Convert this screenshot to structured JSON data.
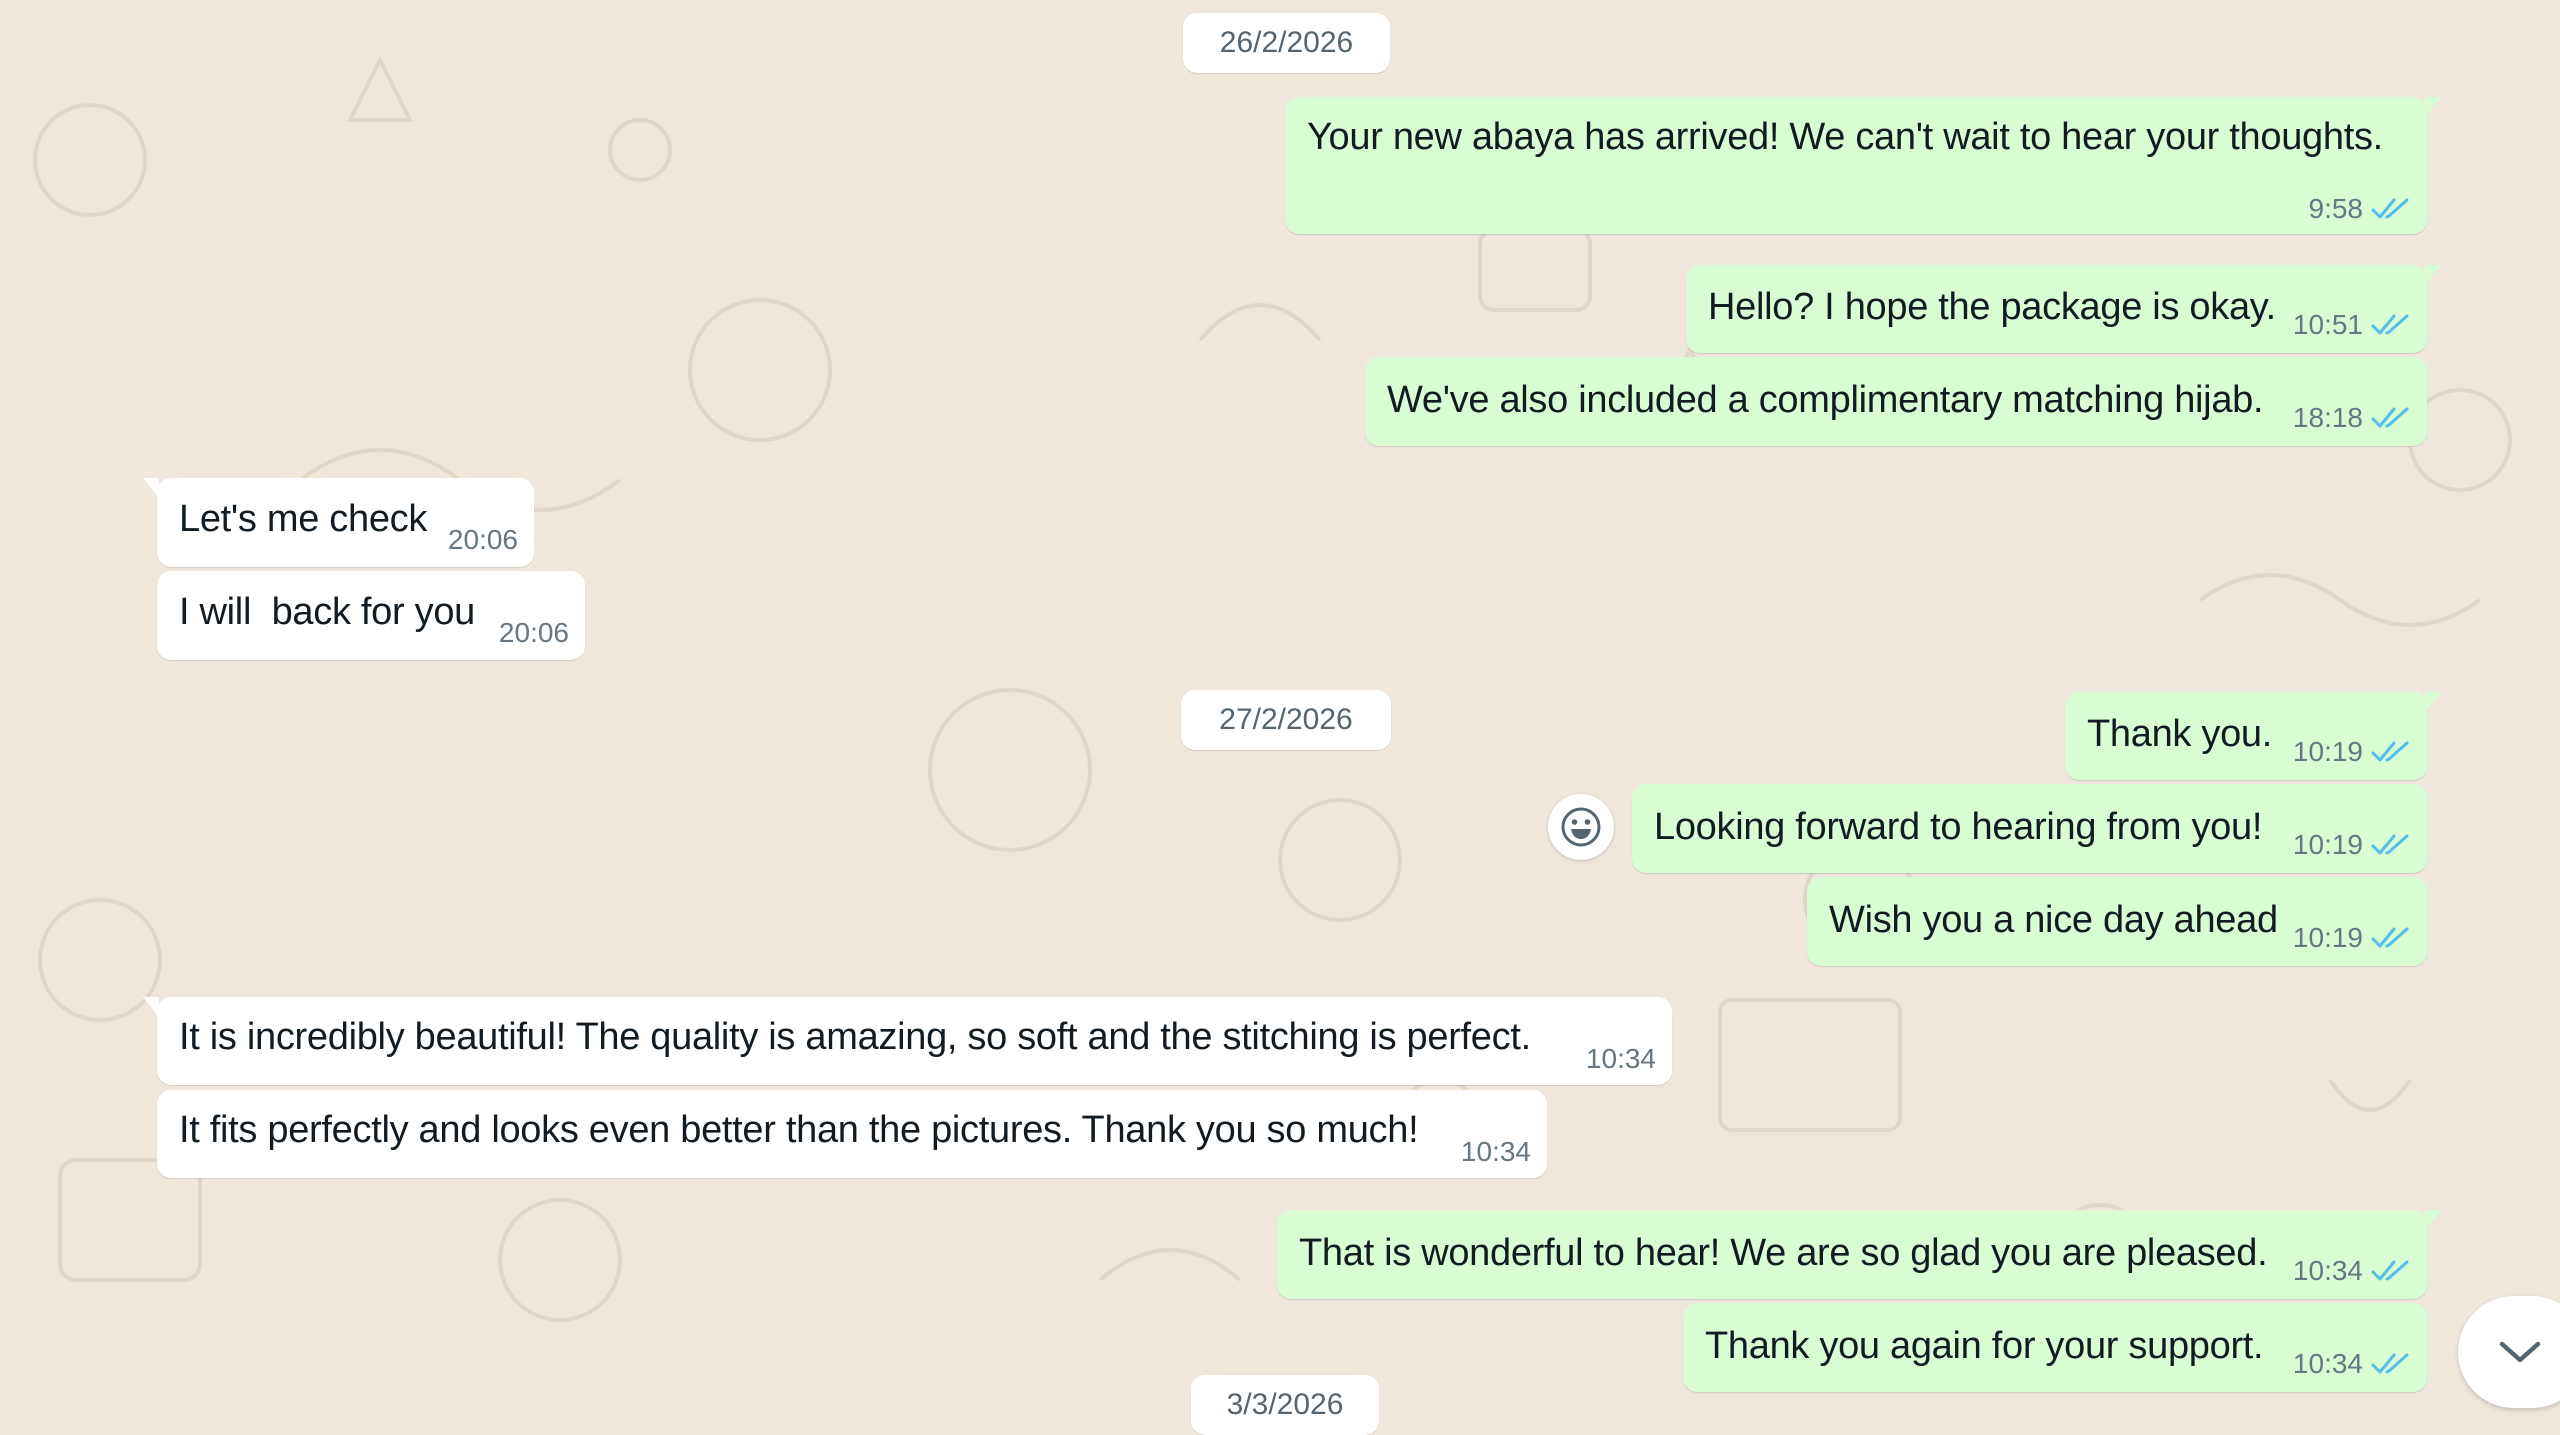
{
  "colors": {
    "background": "#efe7dc",
    "outgoing_bubble": "#d9fdd3",
    "incoming_bubble": "#ffffff",
    "read_ticks": "#53bdeb",
    "timestamp": "#667781"
  },
  "dates": [
    "26/2/2026",
    "27/2/2026",
    "3/3/2026"
  ],
  "messages": [
    {
      "direction": "outgoing",
      "text": "Your new abaya has arrived! We can't wait to hear your thoughts.",
      "time": "9:58",
      "status": "read"
    },
    {
      "direction": "outgoing",
      "text": "Hello? I hope the package is okay.",
      "time": "10:51",
      "status": "read"
    },
    {
      "direction": "outgoing",
      "text": "We've also included a complimentary matching hijab.",
      "time": "18:18",
      "status": "read"
    },
    {
      "direction": "incoming",
      "text": "Let's me check",
      "time": "20:06"
    },
    {
      "direction": "incoming",
      "text": "I will  back for you",
      "time": "20:06"
    },
    {
      "direction": "outgoing",
      "text": "Thank you.",
      "time": "10:19",
      "status": "read"
    },
    {
      "direction": "outgoing",
      "text": "Looking forward to hearing from you!",
      "time": "10:19",
      "status": "read"
    },
    {
      "direction": "outgoing",
      "text": "Wish you a nice day ahead",
      "time": "10:19",
      "status": "read"
    },
    {
      "direction": "incoming",
      "text": "It is incredibly beautiful! The quality is amazing, so soft and the stitching is perfect.",
      "time": "10:34"
    },
    {
      "direction": "incoming",
      "text": "It fits perfectly and looks even better than the pictures. Thank you so much!",
      "time": "10:34"
    },
    {
      "direction": "outgoing",
      "text": "That is wonderful to hear! We are so glad you are pleased.",
      "time": "10:34",
      "status": "read"
    },
    {
      "direction": "outgoing",
      "text": "Thank you again for your support.",
      "time": "10:34",
      "status": "read"
    }
  ],
  "icons": {
    "reaction": "smiley-face-icon",
    "scroll_down": "chevron-down-icon",
    "read_status": "double-check-icon"
  }
}
